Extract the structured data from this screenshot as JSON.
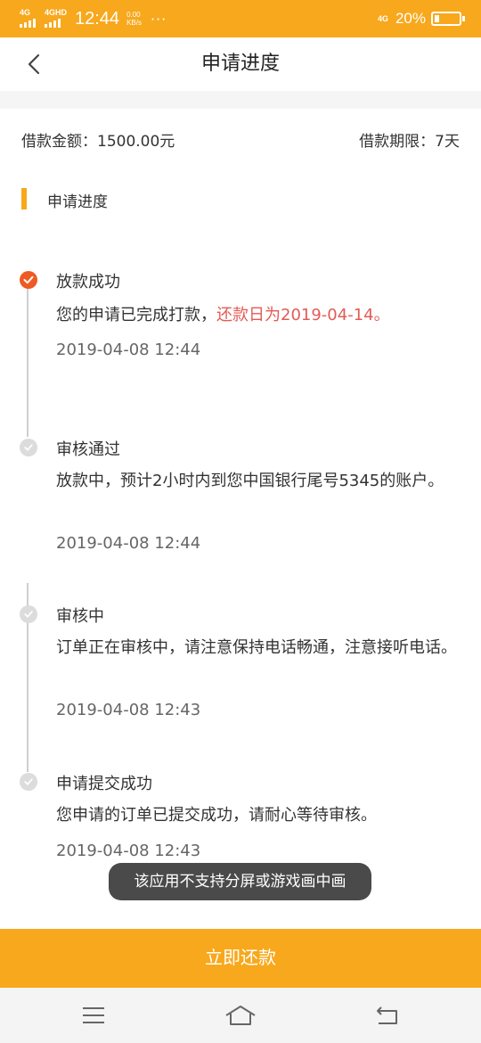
{
  "status_bar": {
    "sim1_label": "4G",
    "sim2_label": "4GHD",
    "time": "12:44",
    "speed_value": "0.00",
    "speed_unit": "KB/s",
    "dots": "···",
    "network_label": "4G",
    "battery_text": "20%",
    "battery_level": 0.2
  },
  "nav": {
    "back_icon": "chevron-left-icon",
    "title": "申请进度"
  },
  "loan": {
    "amount": "借款金额：1500.00元",
    "term": "借款期限：7天"
  },
  "section": {
    "title": "申请进度"
  },
  "timeline": [
    {
      "title": "放款成功",
      "desc_normal": "您的申请已完成打款，",
      "desc_highlight": "还款日为2019-04-14。",
      "time": "2019-04-08 12:44",
      "status": "completed"
    },
    {
      "title": "审核通过",
      "desc": "放款中，预计2小时内到您中国银行尾号5345的账户。",
      "time": "2019-04-08 12:44",
      "status": "done"
    },
    {
      "title": "审核中",
      "desc": "订单正在审核中，请注意保持电话畅通，注意接听电话。",
      "time": "2019-04-08 12:43",
      "status": "done"
    },
    {
      "title": "申请提交成功",
      "desc": "您申请的订单已提交成功，请耐心等待审核。",
      "time": "2019-04-08 12:43",
      "status": "done"
    }
  ],
  "toast": "该应用不支持分屏或游戏画中画",
  "repay_button": "立即还款",
  "bottom_nav": {
    "menu_icon": "menu-icon",
    "home_icon": "home-icon",
    "back_icon": "back-arrow-icon"
  },
  "colors": {
    "accent": "#f8a81c",
    "active_dot": "#ee5a24",
    "highlight_text": "#e35b55"
  }
}
